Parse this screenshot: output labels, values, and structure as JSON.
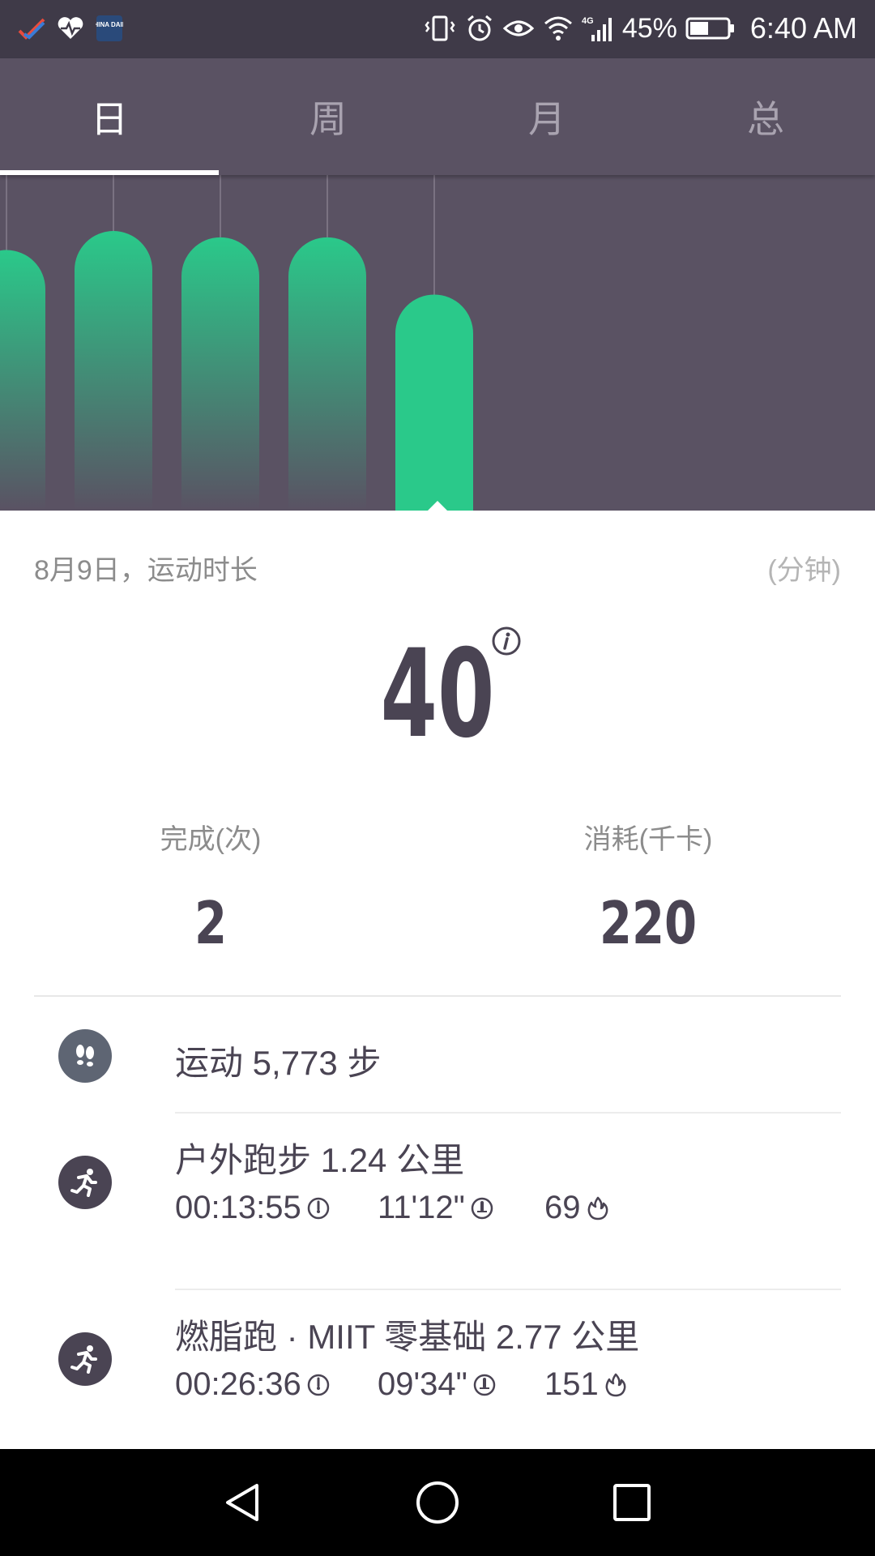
{
  "status_bar": {
    "battery_percent": "45%",
    "time": "6:40 AM",
    "network": "4G",
    "icons": [
      "checkmark-app-icon",
      "heart-rate-icon",
      "china-daily-icon",
      "vibrate-icon",
      "alarm-icon",
      "eye-icon",
      "wifi-icon",
      "signal-icon",
      "battery-icon"
    ],
    "china_daily_text": "CHINA DAILY"
  },
  "tabs": [
    {
      "label": "日",
      "active": true
    },
    {
      "label": "周",
      "active": false
    },
    {
      "label": "月",
      "active": false
    },
    {
      "label": "总",
      "active": false
    }
  ],
  "chart_data": {
    "type": "bar",
    "values": [
      41,
      44,
      43,
      43,
      34
    ],
    "selected_index": 4,
    "ylim": [
      0,
      50
    ],
    "bar_color": "#2ac98a",
    "background": "#5a5263"
  },
  "summary": {
    "date_label": "8月9日，运动时长",
    "unit_label": "(分钟)",
    "duration_value": "40",
    "completed_label": "完成(次)",
    "completed_value": "2",
    "calories_label": "消耗(千卡)",
    "calories_value": "220"
  },
  "activities": [
    {
      "icon": "footsteps-icon",
      "icon_color": "#5e6573",
      "title": "运动 5,773 步"
    },
    {
      "icon": "running-icon",
      "icon_color": "#4a4453",
      "title": "户外跑步 1.24 公里",
      "duration": "00:13:55",
      "pace": "11'12\"",
      "calories": "69"
    },
    {
      "icon": "running-icon",
      "icon_color": "#4a4453",
      "title": "燃脂跑 · MIIT 零基础 2.77 公里",
      "duration": "00:26:36",
      "pace": "09'34\"",
      "calories": "151"
    }
  ],
  "nav": {
    "icons": [
      "back-icon",
      "home-icon",
      "recents-icon"
    ]
  }
}
